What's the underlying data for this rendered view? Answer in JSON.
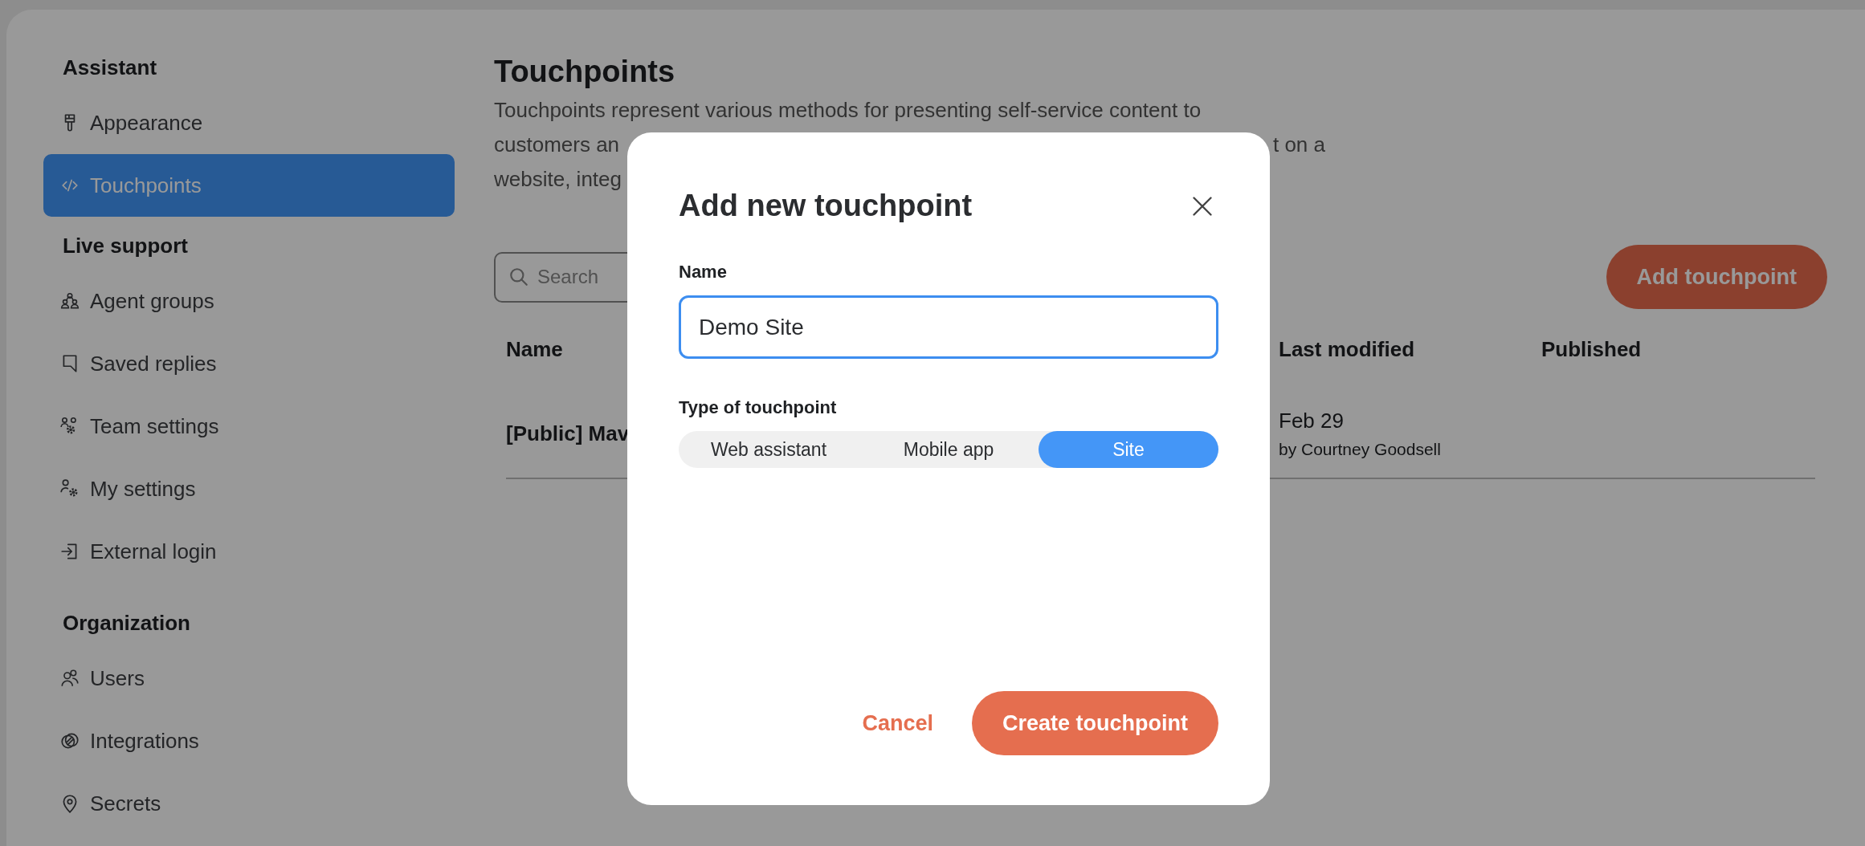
{
  "sidebar": {
    "sections": [
      {
        "heading": "Assistant",
        "items": [
          {
            "label": "Appearance",
            "selected": false
          },
          {
            "label": "Touchpoints",
            "selected": true
          }
        ]
      },
      {
        "heading": "Live support",
        "items": [
          {
            "label": "Agent groups",
            "selected": false
          },
          {
            "label": "Saved replies",
            "selected": false
          },
          {
            "label": "Team settings",
            "selected": false
          },
          {
            "label": "My settings",
            "selected": false
          },
          {
            "label": "External login",
            "selected": false
          }
        ]
      },
      {
        "heading": "Organization",
        "items": [
          {
            "label": "Users",
            "selected": false
          },
          {
            "label": "Integrations",
            "selected": false
          },
          {
            "label": "Secrets",
            "selected": false
          }
        ]
      }
    ]
  },
  "page": {
    "title": "Touchpoints",
    "description_lines": [
      [
        "Touchpoints represent various methods for presenting self-service content to"
      ],
      [
        "customers an",
        "t on a"
      ],
      [
        "website, integ"
      ]
    ],
    "search": {
      "placeholder": "Search"
    },
    "add_button": "Add touchpoint",
    "table": {
      "columns": [
        "Name",
        "Last modified",
        "Published"
      ],
      "rows": [
        {
          "name": "[Public] Mav",
          "modified_date": "Feb 29",
          "modified_by": "by Courtney Goodsell"
        }
      ]
    }
  },
  "dialog": {
    "title": "Add new touchpoint",
    "name_label": "Name",
    "name_value": "Demo Site",
    "type_label": "Type of touchpoint",
    "types": [
      {
        "label": "Web assistant",
        "selected": false
      },
      {
        "label": "Mobile app",
        "selected": false
      },
      {
        "label": "Site",
        "selected": true
      }
    ],
    "cancel": "Cancel",
    "create": "Create touchpoint"
  }
}
